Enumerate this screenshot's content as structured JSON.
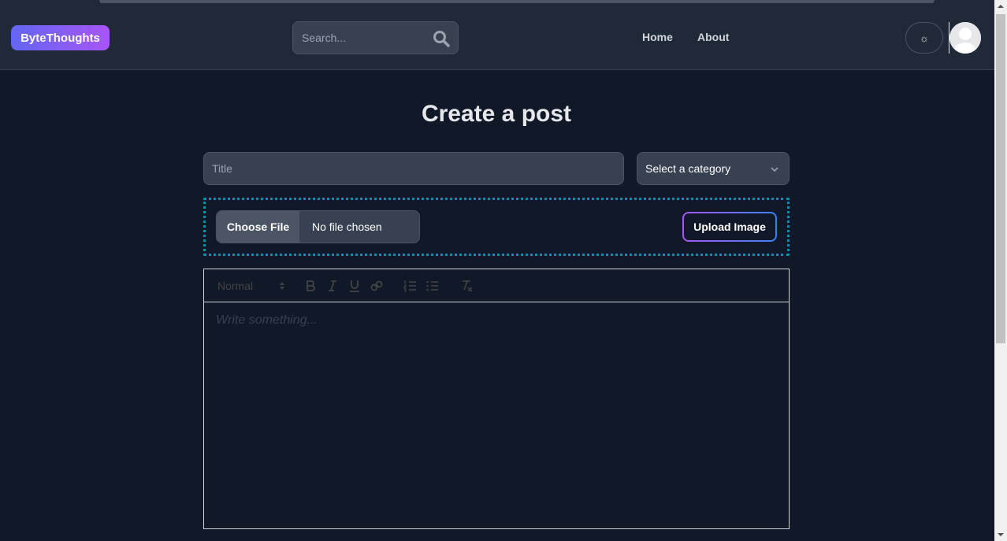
{
  "brand": "ByteThoughts",
  "search": {
    "placeholder": "Search..."
  },
  "nav": {
    "home": "Home",
    "about": "About"
  },
  "theme_toggle": "☼",
  "page": {
    "title": "Create a post",
    "title_placeholder": "Title",
    "category_selected": "Select a category",
    "file": {
      "choose_label": "Choose File",
      "status": "No file chosen"
    },
    "upload_label": "Upload Image",
    "editor": {
      "format_selected": "Normal",
      "placeholder": "Write something..."
    }
  },
  "colors": {
    "background": "#111827",
    "navbar": "#1f2937",
    "brand_gradient": [
      "#6366f1",
      "#a855f7"
    ],
    "dotted_border": "#0891b2",
    "upload_gradient": [
      "#a855f7",
      "#3b82f6"
    ]
  },
  "icons": [
    "search-icon",
    "sun-icon",
    "avatar-icon",
    "chevron-down-icon",
    "bold-icon",
    "italic-icon",
    "underline-icon",
    "link-icon",
    "ordered-list-icon",
    "bullet-list-icon",
    "clear-format-icon"
  ]
}
